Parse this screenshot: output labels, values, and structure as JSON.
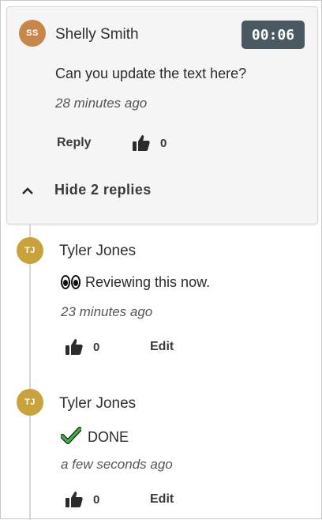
{
  "parent": {
    "avatar_initials": "SS",
    "avatar_color": "#c7874a",
    "author": "Shelly Smith",
    "timestamp": "00:06",
    "text": "Can you update the text here?",
    "time_ago": "28 minutes ago",
    "reply_label": "Reply",
    "likes": "0",
    "hide_replies_label": "Hide 2 replies"
  },
  "replies": [
    {
      "avatar_initials": "TJ",
      "avatar_color": "#c9a23c",
      "author": "Tyler Jones",
      "emoji": "eyes",
      "text": "Reviewing this now.",
      "time_ago": "23 minutes ago",
      "likes": "0",
      "edit_label": "Edit"
    },
    {
      "avatar_initials": "TJ",
      "avatar_color": "#c9a23c",
      "author": "Tyler Jones",
      "emoji": "heavy-check-mark",
      "text": "DONE",
      "time_ago": "a few seconds ago",
      "likes": "0",
      "edit_label": "Edit"
    }
  ]
}
